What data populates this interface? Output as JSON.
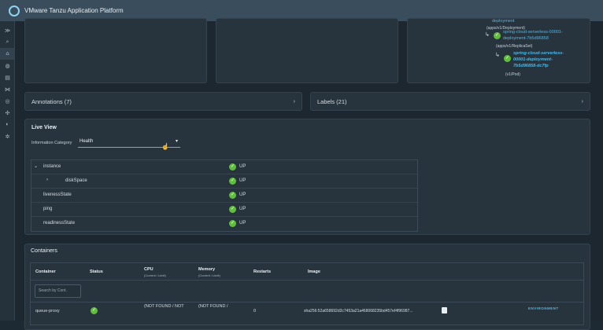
{
  "app": {
    "title": "VMware Tanzu Application Platform"
  },
  "sidebar": {
    "items": [
      {
        "icon": "expand-icon",
        "glyph": "≫"
      },
      {
        "icon": "search-icon",
        "glyph": "⌕"
      },
      {
        "icon": "home-icon",
        "glyph": "⌂"
      },
      {
        "icon": "catalog-icon",
        "glyph": "◍"
      },
      {
        "icon": "docs-icon",
        "glyph": "▤"
      },
      {
        "icon": "graph-icon",
        "glyph": "⋈"
      },
      {
        "icon": "globe-icon",
        "glyph": "◎"
      },
      {
        "icon": "puzzle-icon",
        "glyph": "✣"
      },
      {
        "icon": "apis-icon",
        "glyph": "◐"
      },
      {
        "icon": "settings-icon",
        "glyph": "✲"
      }
    ]
  },
  "resource_tree": {
    "line1": "deployment",
    "type1": "(apps/v1/Deployment)",
    "link1a": "spring-cloud-serverless-00001-",
    "link1b": "deployment-7b5d96858",
    "type2": "(apps/v1/ReplicaSet)",
    "link2a": "spring-cloud-serverless-",
    "link2b": "00001-deployment-",
    "link2c": "7b5d96858-dc7fp",
    "type3": "(v1/Pod)"
  },
  "annotations": {
    "label": "Annotations (7)"
  },
  "labels": {
    "label": "Labels (21)"
  },
  "live_view": {
    "title": "Live View",
    "info_category_label": "Information Category",
    "info_category_value": "Health",
    "rows": [
      {
        "label": "instance",
        "status": "UP",
        "chevron": "⌄"
      },
      {
        "label": "diskSpace",
        "status": "UP",
        "chevron": "›"
      },
      {
        "label": "livenessState",
        "status": "UP",
        "chevron": ""
      },
      {
        "label": "ping",
        "status": "UP",
        "chevron": ""
      },
      {
        "label": "readinessState",
        "status": "UP",
        "chevron": ""
      }
    ]
  },
  "containers": {
    "title": "Containers",
    "headers": {
      "container": "Container",
      "status": "Status",
      "cpu": "CPU",
      "cpu_sub": "(Current / Limit)",
      "memory": "Memory",
      "memory_sub": "(Current / Limit)",
      "restarts": "Restarts",
      "image": "Image"
    },
    "search_placeholder": "Search by Cont.",
    "row": {
      "name": "queue-proxy",
      "cpu": "(NOT FOUND / NOT",
      "memory": "(NOT FOUND /",
      "restarts": "0",
      "image": "sha256:52a658692d2c7453a21a468068235bd457ef4f96987..."
    },
    "env_badge": "ENVIRONMENT"
  }
}
